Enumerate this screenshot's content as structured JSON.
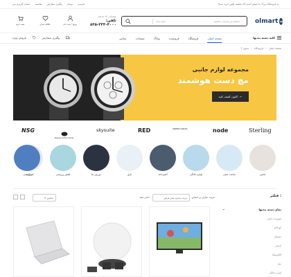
{
  "topbar": {
    "promo": "به فروشگاه بزرگ ما خوش آمدید (کد تخفیف اولین خرید شما)",
    "lang": "فارسی",
    "currency": "تومان",
    "track": "پیگیری سفارش",
    "compare": "مقایسه",
    "account": "حساب کاربری من"
  },
  "header": {
    "logo": "olmart",
    "search_placeholder": "جستجو بین هزاران محصول ...",
    "search_category": "دسته بندی",
    "phone_label": "پشتیبانی ۲۴ ساعته",
    "phone": "تلفن: ۴۰۰۰-۳۳۳-۸۴۵",
    "cart": "سبد خرید",
    "wishlist": "علاقه مندی",
    "login": "ورود / ثبت نام"
  },
  "nav": {
    "categories": "کلیه دسته بندیها",
    "items": [
      "صفحه اصلی",
      "فروشگاه",
      "فروشنده",
      "وبلاگ",
      "صفحات",
      "عناصر"
    ],
    "track": "پیگیری سفارش",
    "special": "فروش ویژه"
  },
  "breadcrumb": [
    "صفحه اصلی",
    "فروشگاه",
    "۳ ستون"
  ],
  "banner": {
    "title": "مجموعه لوازم جانبی",
    "subtitle": "مچ دست هوشمند",
    "button": "اکنون کشف کنید"
  },
  "brands": [
    "NSG",
    "Dayan Auto Comp",
    "skysuite",
    "RED",
    "GREEN GRASS",
    "node",
    "Sterling"
  ],
  "categories": [
    "لباس",
    "ساعت مچی",
    "لوازم خانگی",
    "آشپزخانه",
    "بازی",
    "دوربین ها",
    "کفش ورزشی",
    "کودکانه",
    "ورزشی"
  ],
  "toolbar": {
    "sort_label": "مرتب سازی بر اساس :",
    "sort_value": "مرتب سازی پیش فرض",
    "per_page": "نمایش ۱۲",
    "sort_by": "حذف همه"
  },
  "sidebar": {
    "filter_title": "فیلتر :",
    "cat_title": "تمام دسته بندیها",
    "items": [
      "تجهیزات جانبی",
      "کودکانه",
      "دیجیتال",
      "آرایش",
      "الکترونیک",
      "مبل",
      "لوازم خانگی"
    ]
  },
  "colors": {
    "accent": "#1c5bd4",
    "brand": "#1c3f6e",
    "banner_bg": "#f7c643"
  }
}
